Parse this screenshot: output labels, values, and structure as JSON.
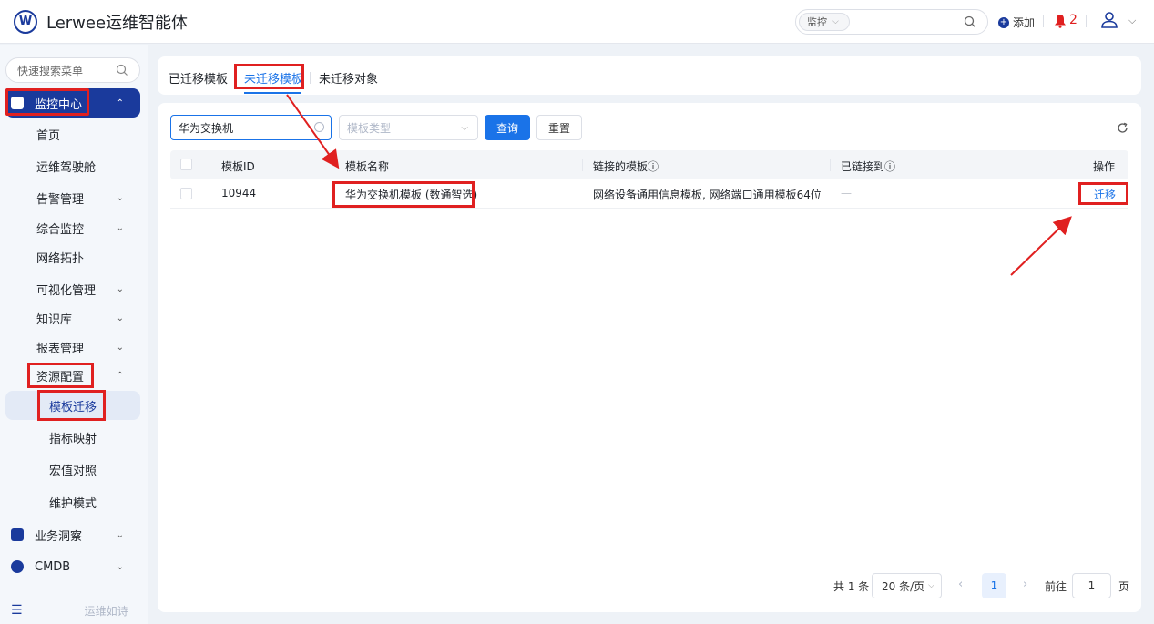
{
  "header": {
    "logo_letter": "W",
    "app_title": "Lerwee运维智能体",
    "search_scope": "监控",
    "search_value": "",
    "add_label": "添加",
    "alert_count": "2"
  },
  "sidebar": {
    "search_placeholder": "快速搜索菜单",
    "items": [
      {
        "label": "监控中心",
        "state": "expanded-active"
      },
      {
        "label": "首页"
      },
      {
        "label": "运维驾驶舱"
      },
      {
        "label": "告警管理",
        "expandable": true
      },
      {
        "label": "综合监控",
        "expandable": true
      },
      {
        "label": "网络拓扑"
      },
      {
        "label": "可视化管理",
        "expandable": true
      },
      {
        "label": "知识库",
        "expandable": true
      },
      {
        "label": "报表管理",
        "expandable": true
      },
      {
        "label": "资源配置",
        "state": "expanded"
      },
      {
        "label": "模板迁移",
        "state": "active"
      },
      {
        "label": "指标映射"
      },
      {
        "label": "宏值对照"
      },
      {
        "label": "维护模式"
      },
      {
        "label": "业务洞察",
        "expandable": true
      },
      {
        "label": "CMDB",
        "expandable": true
      }
    ],
    "slogan": "运维如诗",
    "colors": {
      "active_bg": "#1a3a9c",
      "leaf_active_bg": "#e3eaf6"
    }
  },
  "tabs": [
    {
      "label": "已迁移模板"
    },
    {
      "label": "未迁移模板",
      "active": true
    },
    {
      "label": "未迁移对象"
    }
  ],
  "filters": {
    "name_value": "华为交换机",
    "type_placeholder": "模板类型",
    "query_label": "查询",
    "reset_label": "重置"
  },
  "table": {
    "columns": [
      "模板ID",
      "模板名称",
      "链接的模板ⓘ",
      "已链接到ⓘ",
      "操作"
    ],
    "rows": [
      {
        "id": "10944",
        "name": "华为交换机模板 (数通智选)",
        "linked_templates": "网络设备通用信息模板, 网络端口通用模板64位",
        "linked_to": "—",
        "action": "迁移"
      }
    ]
  },
  "pagination": {
    "total_label": "共 1 条",
    "page_size_label": "20 条/页",
    "current_page": "1",
    "goto_label": "前往",
    "goto_value": "1",
    "page_unit": "页"
  },
  "colors": {
    "primary": "#1a73e8",
    "brand": "#1a3a9c",
    "annotation_red": "#e02020"
  }
}
